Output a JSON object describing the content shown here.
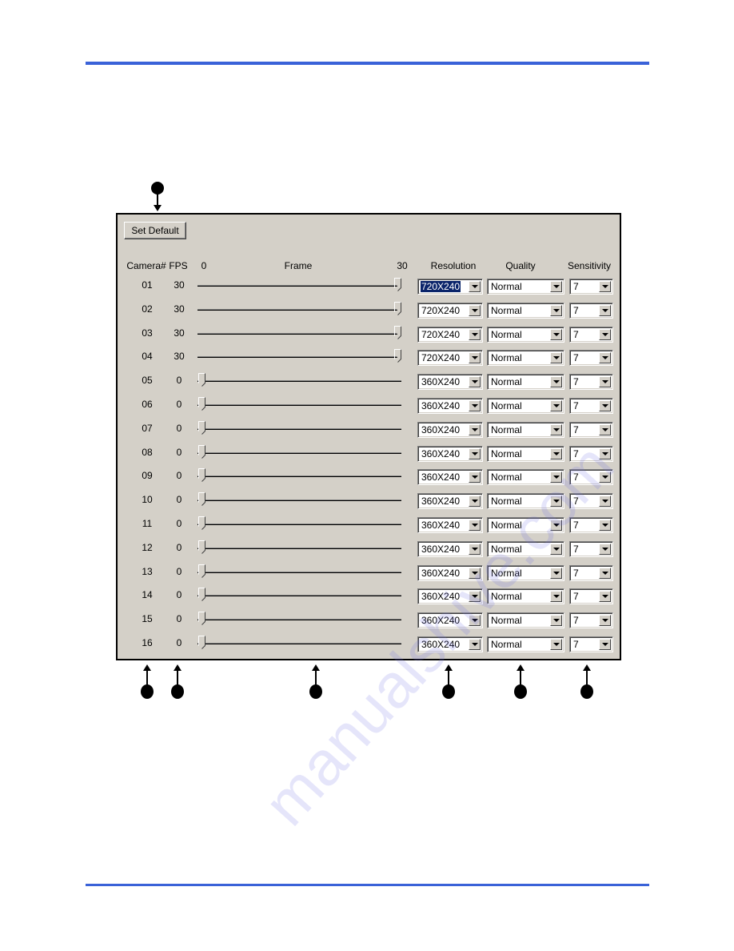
{
  "panel": {
    "set_default_label": "Set Default",
    "headers": {
      "camera": "Camera#",
      "fps": "FPS",
      "frame_min": "0",
      "frame": "Frame",
      "frame_max": "30",
      "resolution": "Resolution",
      "quality": "Quality",
      "sensitivity": "Sensitivity"
    },
    "frame_range": [
      0,
      30
    ],
    "rows": [
      {
        "camera": "01",
        "fps": "30",
        "frame_value": 30,
        "resolution": "720X240",
        "quality": "Normal",
        "sensitivity": "7",
        "resolution_selected": true
      },
      {
        "camera": "02",
        "fps": "30",
        "frame_value": 30,
        "resolution": "720X240",
        "quality": "Normal",
        "sensitivity": "7"
      },
      {
        "camera": "03",
        "fps": "30",
        "frame_value": 30,
        "resolution": "720X240",
        "quality": "Normal",
        "sensitivity": "7"
      },
      {
        "camera": "04",
        "fps": "30",
        "frame_value": 30,
        "resolution": "720X240",
        "quality": "Normal",
        "sensitivity": "7"
      },
      {
        "camera": "05",
        "fps": "0",
        "frame_value": 0,
        "resolution": "360X240",
        "quality": "Normal",
        "sensitivity": "7"
      },
      {
        "camera": "06",
        "fps": "0",
        "frame_value": 0,
        "resolution": "360X240",
        "quality": "Normal",
        "sensitivity": "7"
      },
      {
        "camera": "07",
        "fps": "0",
        "frame_value": 0,
        "resolution": "360X240",
        "quality": "Normal",
        "sensitivity": "7"
      },
      {
        "camera": "08",
        "fps": "0",
        "frame_value": 0,
        "resolution": "360X240",
        "quality": "Normal",
        "sensitivity": "7"
      },
      {
        "camera": "09",
        "fps": "0",
        "frame_value": 0,
        "resolution": "360X240",
        "quality": "Normal",
        "sensitivity": "7"
      },
      {
        "camera": "10",
        "fps": "0",
        "frame_value": 0,
        "resolution": "360X240",
        "quality": "Normal",
        "sensitivity": "7"
      },
      {
        "camera": "11",
        "fps": "0",
        "frame_value": 0,
        "resolution": "360X240",
        "quality": "Normal",
        "sensitivity": "7"
      },
      {
        "camera": "12",
        "fps": "0",
        "frame_value": 0,
        "resolution": "360X240",
        "quality": "Normal",
        "sensitivity": "7"
      },
      {
        "camera": "13",
        "fps": "0",
        "frame_value": 0,
        "resolution": "360X240",
        "quality": "Normal",
        "sensitivity": "7"
      },
      {
        "camera": "14",
        "fps": "0",
        "frame_value": 0,
        "resolution": "360X240",
        "quality": "Normal",
        "sensitivity": "7"
      },
      {
        "camera": "15",
        "fps": "0",
        "frame_value": 0,
        "resolution": "360X240",
        "quality": "Normal",
        "sensitivity": "7"
      },
      {
        "camera": "16",
        "fps": "0",
        "frame_value": 0,
        "resolution": "360X240",
        "quality": "Normal",
        "sensitivity": "7"
      }
    ]
  },
  "callouts": {
    "top": [
      "set-default"
    ],
    "bottom": [
      "camera",
      "fps",
      "frame",
      "resolution",
      "quality",
      "sensitivity"
    ]
  },
  "colors": {
    "rule": "#3A62D8",
    "panel_bg": "#D4D0C8",
    "selection": "#0A246A"
  },
  "watermark": "manualshive.com"
}
